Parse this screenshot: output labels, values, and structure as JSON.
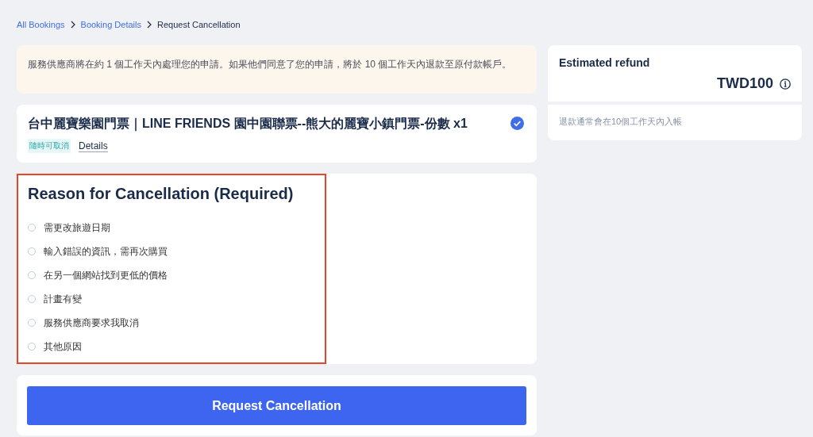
{
  "breadcrumb": [
    {
      "label": "All Bookings",
      "link": true
    },
    {
      "label": "Booking Details",
      "link": true
    },
    {
      "label": "Request Cancellation",
      "link": false
    }
  ],
  "notice": "服務供應商將在約 1 個工作天內處理您的申請。如果他們同意了您的申請，將於 10 個工作天內退款至原付款帳戶。",
  "product": {
    "title": "台中麗寶樂園門票｜LINE FRIENDS 園中園聯票--熊大的麗寶小鎮門票-份數 x1",
    "checked": true,
    "tag": "隨時可取消",
    "details_link": "Details"
  },
  "reason": {
    "title": "Reason for Cancellation (Required)",
    "highlighted": true,
    "options": [
      {
        "label": "需更改旅遊日期",
        "selected": false
      },
      {
        "label": "輸入錯誤的資訊，需再次購買",
        "selected": false
      },
      {
        "label": "在另一個網站找到更低的價格",
        "selected": false
      },
      {
        "label": "計畫有變",
        "selected": false
      },
      {
        "label": "服務供應商要求我取消",
        "selected": false
      },
      {
        "label": "其他原因",
        "selected": false
      }
    ]
  },
  "submit_button": "Request Cancellation",
  "refund": {
    "title": "Estimated refund",
    "amount": "TWD100",
    "note": "退款通常會在10個工作天內入帳"
  }
}
